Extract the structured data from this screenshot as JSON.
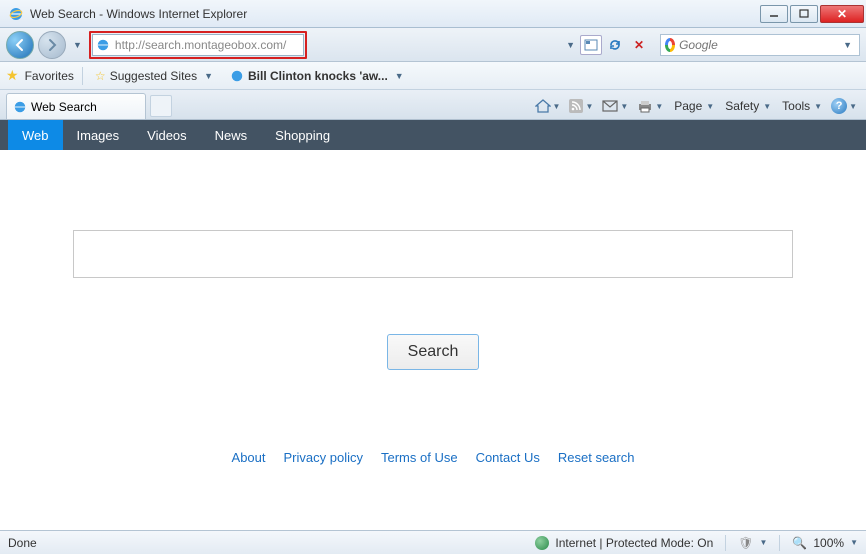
{
  "window": {
    "title": "Web Search - Windows Internet Explorer"
  },
  "nav": {
    "url": "http://search.montageobox.com/",
    "search_provider_placeholder": "Google"
  },
  "favorites": {
    "label": "Favorites",
    "suggested": "Suggested Sites",
    "headline": "Bill Clinton knocks 'aw..."
  },
  "tab": {
    "title": "Web Search"
  },
  "toolbar": {
    "page": "Page",
    "safety": "Safety",
    "tools": "Tools"
  },
  "pagebar": {
    "items": [
      "Web",
      "Images",
      "Videos",
      "News",
      "Shopping"
    ]
  },
  "search": {
    "button": "Search",
    "value": ""
  },
  "footer": {
    "links": [
      "About",
      "Privacy policy",
      "Terms of Use",
      "Contact Us",
      "Reset search"
    ]
  },
  "status": {
    "left": "Done",
    "security": "Internet | Protected Mode: On",
    "zoom": "100%"
  }
}
